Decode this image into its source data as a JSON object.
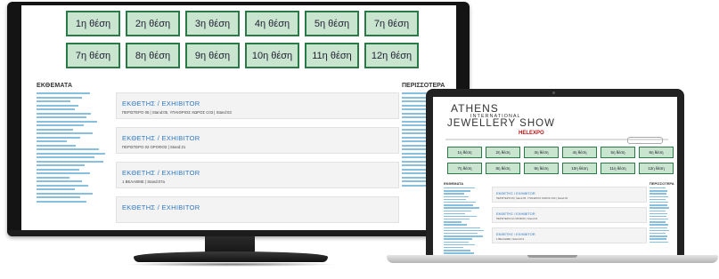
{
  "monitor": {
    "positions_row1": [
      "1η θέση",
      "2η θέση",
      "3η θέση",
      "4η θέση",
      "5η θέση",
      "7η θέση"
    ],
    "positions_row2": [
      "7η θέση",
      "8η θέση",
      "9η θέση",
      "10η θέση",
      "11η θέση",
      "12η θέση"
    ],
    "sidebar_title": "ΕΚΘΕΜΑΤΑ",
    "right_title": "ΠΕΡΙΣΣΟΤΕΡΑ",
    "cards": [
      {
        "title": "ΕΚΘΕΤΗΣ / EXHIBITOR",
        "sub": "ΠΕΡΙΣΤΕΡΟ 05 | Stand:05, ΥΠΑΙΘΡΙΟΣ ΧΩΡΟΣ C03 | Stand:03"
      },
      {
        "title": "ΕΚΘΕΤΗΣ / EXHIBITOR",
        "sub": "ΠΕΡΙΣΤΕΡΟ 02 ΟΡΟΦΟΣ | Stand:21"
      },
      {
        "title": "ΕΚΘΕΤΗΣ / EXHIBITOR",
        "sub": "1 ΒΕΛΑΘΜΕ | Stand:07a"
      },
      {
        "title": "ΕΚΘΕΤΗΣ / EXHIBITOR",
        "sub": ""
      }
    ]
  },
  "laptop": {
    "logo_line1": "ATHENS",
    "logo_line2": "INTERNATIONAL",
    "logo_line3": "JEWELLERY SHOW",
    "logo_brand": "HELEXPO",
    "positions_row1": [
      "1η θέση",
      "2η θέση",
      "3η θέση",
      "4η θέση",
      "5η θέση",
      "6η θέση"
    ],
    "positions_row2": [
      "7η θέση",
      "8η θέση",
      "9η θέση",
      "10η θέση",
      "11η θέση",
      "12η θέση"
    ],
    "sidebar_title": "ΕΚΘΕΜΑΤΑ",
    "right_title": "ΠΕΡΙΣΣΟΤΕΡΑ",
    "cards": [
      {
        "title": "ΕΚΘΕΤΗΣ / EXHIBITOR",
        "sub": "ΠΕΡΙΣΤΕΡΟ 05 | Stand:05, ΥΠΑΙΘΡΙΟΣ ΧΩΡΟΣ C03 | Stand:03"
      },
      {
        "title": "ΕΚΘΕΤΗΣ / EXHIBITOR",
        "sub": "ΠΕΡΙΣΤΕΡΟ 02 ΟΡΟΦΟΣ | Stand:21"
      },
      {
        "title": "ΕΚΘΕΤΗΣ / EXHIBITOR",
        "sub": "1 ΒΕΛΑΘΜΕ | Stand:07a"
      }
    ]
  }
}
